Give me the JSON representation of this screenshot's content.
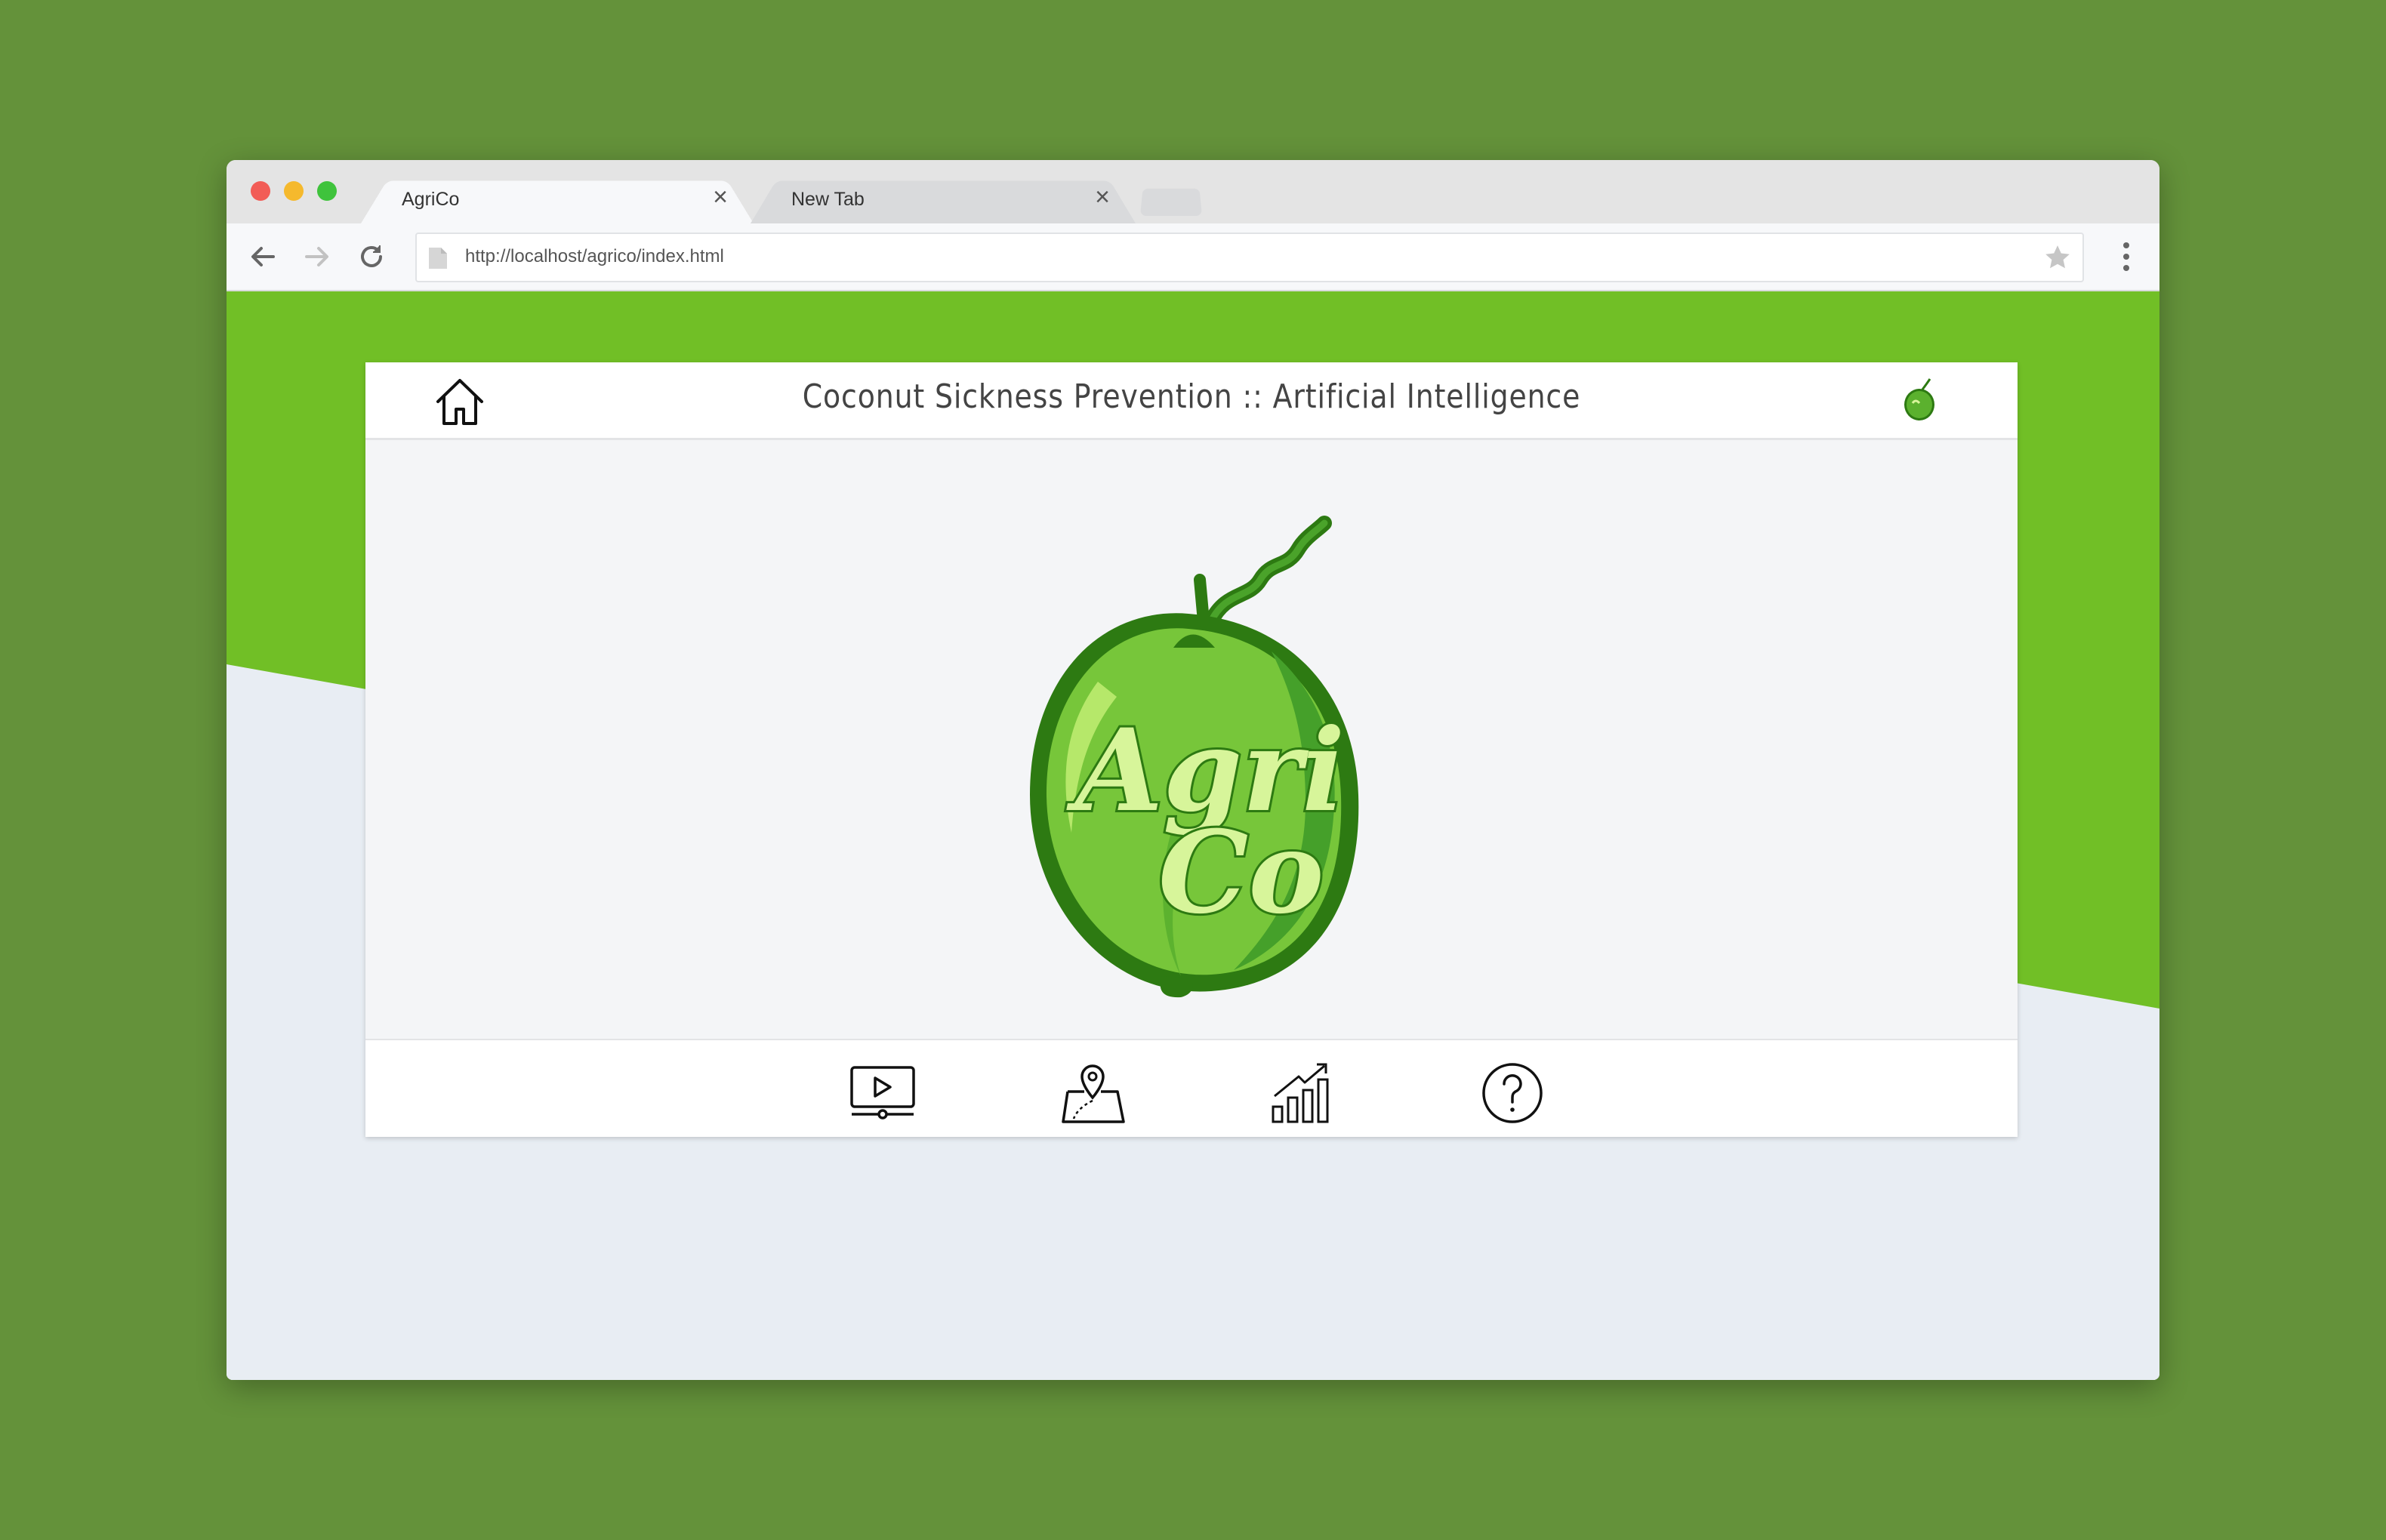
{
  "browser": {
    "tabs": [
      {
        "label": "AgriCo",
        "active": true
      },
      {
        "label": "New Tab",
        "active": false
      }
    ],
    "url": "http://localhost/agrico/index.html"
  },
  "header": {
    "title": "Coconut Sickness Prevention :: Artificial Intelligence"
  },
  "logo": {
    "text_line1": "Agri",
    "text_line2": "Co"
  },
  "footer": {
    "icons": [
      "video-icon",
      "map-location-icon",
      "growth-chart-icon",
      "help-icon"
    ]
  },
  "colors": {
    "brand_green": "#71bf26",
    "coconut_dark": "#2d7a12",
    "coconut_mid": "#4aa32a",
    "coconut_light": "#77c63a",
    "logo_text": "#d7f59a"
  }
}
